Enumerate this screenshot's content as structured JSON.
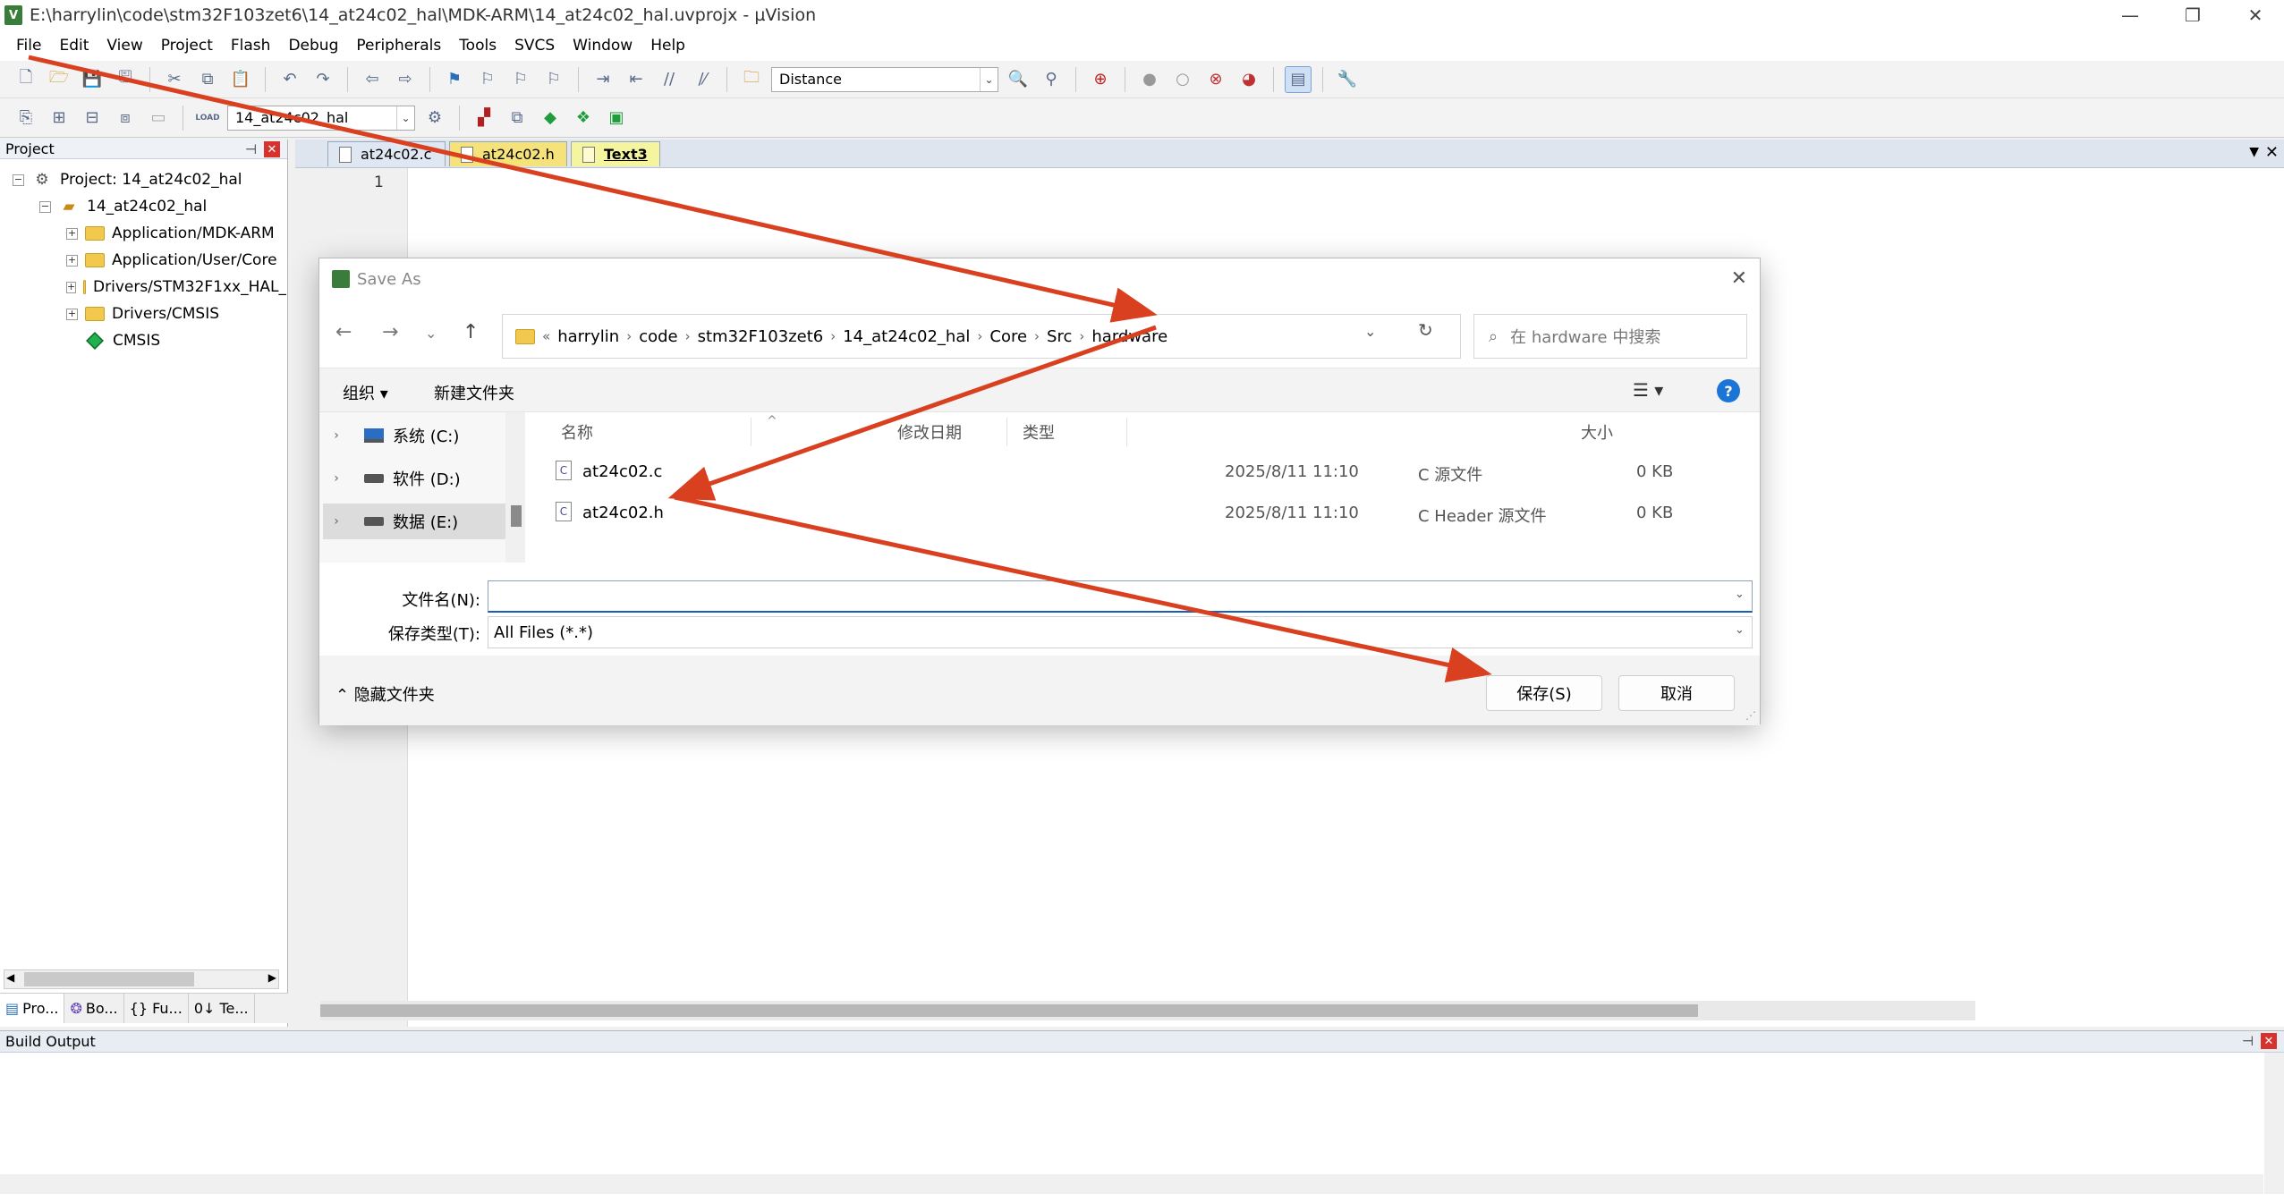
{
  "window": {
    "title": "E:\\harrylin\\code\\stm32F103zet6\\14_at24c02_hal\\MDK-ARM\\14_at24c02_hal.uvprojx - µVision",
    "app_icon_glyph": "V",
    "controls": {
      "minimize": "—",
      "restore": "❐",
      "close": "✕"
    }
  },
  "menu": [
    "File",
    "Edit",
    "View",
    "Project",
    "Flash",
    "Debug",
    "Peripherals",
    "Tools",
    "SVCS",
    "Window",
    "Help"
  ],
  "toolbar1": {
    "find_combo_value": "Distance",
    "icons": [
      "new-file-icon",
      "open-file-icon",
      "save-icon",
      "save-all-icon",
      "cut-icon",
      "copy-icon",
      "paste-icon",
      "undo-icon",
      "redo-icon",
      "nav-back-icon",
      "nav-forward-icon",
      "bookmark-icon",
      "indent-icon",
      "outdent-icon",
      "comment-icon",
      "find-in-files-icon",
      "debug-icon",
      "breakpoint-icon",
      "window-layout-icon",
      "configure-icon"
    ]
  },
  "toolbar2": {
    "target_combo_value": "14_at24c02_hal",
    "load_label": "LOAD"
  },
  "project_panel": {
    "title": "Project",
    "pin": "⊣",
    "close": "✕",
    "tree": [
      {
        "label": "Project: 14_at24c02_hal",
        "level": 0,
        "expander": "−",
        "kind": "project"
      },
      {
        "label": "14_at24c02_hal",
        "level": 1,
        "expander": "−",
        "kind": "target"
      },
      {
        "label": "Application/MDK-ARM",
        "level": 2,
        "expander": "+",
        "kind": "folder"
      },
      {
        "label": "Application/User/Core",
        "level": 2,
        "expander": "+",
        "kind": "folder"
      },
      {
        "label": "Drivers/STM32F1xx_HAL_",
        "level": 2,
        "expander": "+",
        "kind": "folder"
      },
      {
        "label": "Drivers/CMSIS",
        "level": 2,
        "expander": "+",
        "kind": "folder"
      },
      {
        "label": "CMSIS",
        "level": 2,
        "expander": "",
        "kind": "gem"
      }
    ],
    "tabs": [
      "Pro...",
      "Bo...",
      "{} Fu...",
      "0↓ Te..."
    ]
  },
  "editor": {
    "tabs": [
      {
        "label": "at24c02.c",
        "style": "normal"
      },
      {
        "label": "at24c02.h",
        "style": "yellow"
      },
      {
        "label": "Text3",
        "style": "active"
      }
    ],
    "line_number": "1",
    "tab_menu": "▼",
    "tab_close": "✕"
  },
  "build_output": {
    "title": "Build Output",
    "pin": "⊣",
    "close": "✕"
  },
  "save_dialog": {
    "title": "Save As",
    "close": "✕",
    "nav": {
      "back": "←",
      "forward": "→",
      "recent": "⌄",
      "up": "↑"
    },
    "breadcrumb_prefix": "«",
    "breadcrumb": [
      "harrylin",
      "code",
      "stm32F103zet6",
      "14_at24c02_hal",
      "Core",
      "Src",
      "hardware"
    ],
    "breadcrumb_sep": "›",
    "address_dropdown": "⌄",
    "refresh": "↻",
    "search_placeholder": "在 hardware 中搜索",
    "search_glyph": "⌕",
    "organize_label": "组织 ▾",
    "new_folder_label": "新建文件夹",
    "view_icon": "☰ ▾",
    "help_glyph": "?",
    "drives": [
      {
        "label": "系统 (C:)",
        "chev": "›",
        "kind": "os"
      },
      {
        "label": "软件 (D:)",
        "chev": "›",
        "kind": "disk"
      },
      {
        "label": "数据 (E:)",
        "chev": "›",
        "kind": "disk",
        "selected": true
      }
    ],
    "columns": {
      "name": "名称",
      "date": "修改日期",
      "type": "类型",
      "size": "大小",
      "sort_glyph": "^"
    },
    "files": [
      {
        "name": "at24c02.c",
        "date": "2025/8/11 11:10",
        "type": "C 源文件",
        "size": "0 KB",
        "icon_glyph": "C"
      },
      {
        "name": "at24c02.h",
        "date": "2025/8/11 11:10",
        "type": "C Header 源文件",
        "size": "0 KB",
        "icon_glyph": "C"
      }
    ],
    "filename_label": "文件名(N):",
    "filename_value": "",
    "filetype_label": "保存类型(T):",
    "filetype_value": "All Files (*.*)",
    "select_arrow": "⌄",
    "hide_folders_label": "⌃  隐藏文件夹",
    "save_label": "保存(S)",
    "cancel_label": "取消",
    "resize_grip": "⋰"
  },
  "colors": {
    "annotation_arrow": "#d9401f",
    "accent_blue": "#1a75d6",
    "folder_yellow": "#f2c94c",
    "close_red": "#d6322e"
  }
}
